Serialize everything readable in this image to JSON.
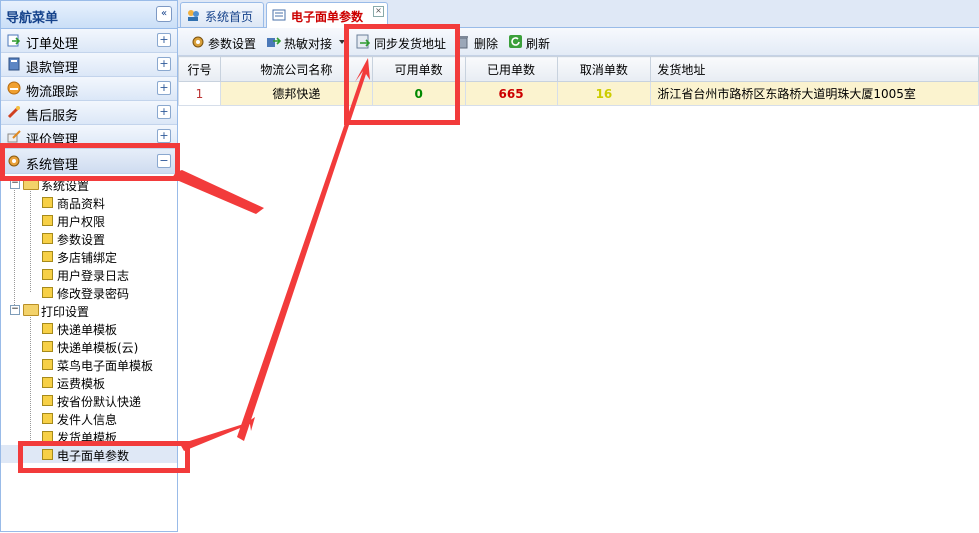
{
  "nav": {
    "title": "导航菜单",
    "collapse_icon": "«",
    "sections": [
      {
        "label": "订单处理",
        "icon": "order-icon",
        "toggle": "+"
      },
      {
        "label": "退款管理",
        "icon": "refund-icon",
        "toggle": "+"
      },
      {
        "label": "物流跟踪",
        "icon": "logistics-icon",
        "toggle": "+"
      },
      {
        "label": "售后服务",
        "icon": "aftersales-icon",
        "toggle": "+"
      },
      {
        "label": "评价管理",
        "icon": "review-icon",
        "toggle": "+"
      },
      {
        "label": "系统管理",
        "icon": "gear-icon",
        "toggle": "−"
      }
    ],
    "tree": {
      "system_settings": {
        "label": "系统设置",
        "toggle": "−",
        "items": [
          "商品资料",
          "用户权限",
          "参数设置",
          "多店铺绑定",
          "用户登录日志",
          "修改登录密码"
        ]
      },
      "print_settings": {
        "label": "打印设置",
        "toggle": "−",
        "items": [
          "快递单模板",
          "快递单模板(云)",
          "菜鸟电子面单模板",
          "运费模板",
          "按省份默认快递",
          "发件人信息",
          "发货单模板",
          "电子面单参数"
        ]
      }
    }
  },
  "tabs": [
    {
      "label": "系统首页",
      "icon": "home-icon"
    },
    {
      "label": "电子面单参数",
      "icon": "sheet-icon",
      "close": "×"
    }
  ],
  "toolbar": {
    "params": "参数设置",
    "hotkey": "热敏对接",
    "sync": "同步发货地址",
    "delete": "删除",
    "refresh": "刷新"
  },
  "grid": {
    "headers": {
      "row": "行号",
      "company": "物流公司名称",
      "available": "可用单数",
      "used": "已用单数",
      "cancelled": "取消单数",
      "address": "发货地址"
    },
    "rows": [
      {
        "row": "1",
        "company": "德邦快递",
        "available": "0",
        "used": "665",
        "cancelled": "16",
        "address": "浙江省台州市路桥区东路桥大道明珠大厦1005室"
      }
    ]
  },
  "colors": {
    "annotation_red": "#f23b3b",
    "active_tab_text": "#cc0000",
    "available_green": "#008800",
    "used_red": "#cc0000",
    "cancel_yellow": "#cccc00",
    "row_highlight": "#fbf3cf"
  }
}
